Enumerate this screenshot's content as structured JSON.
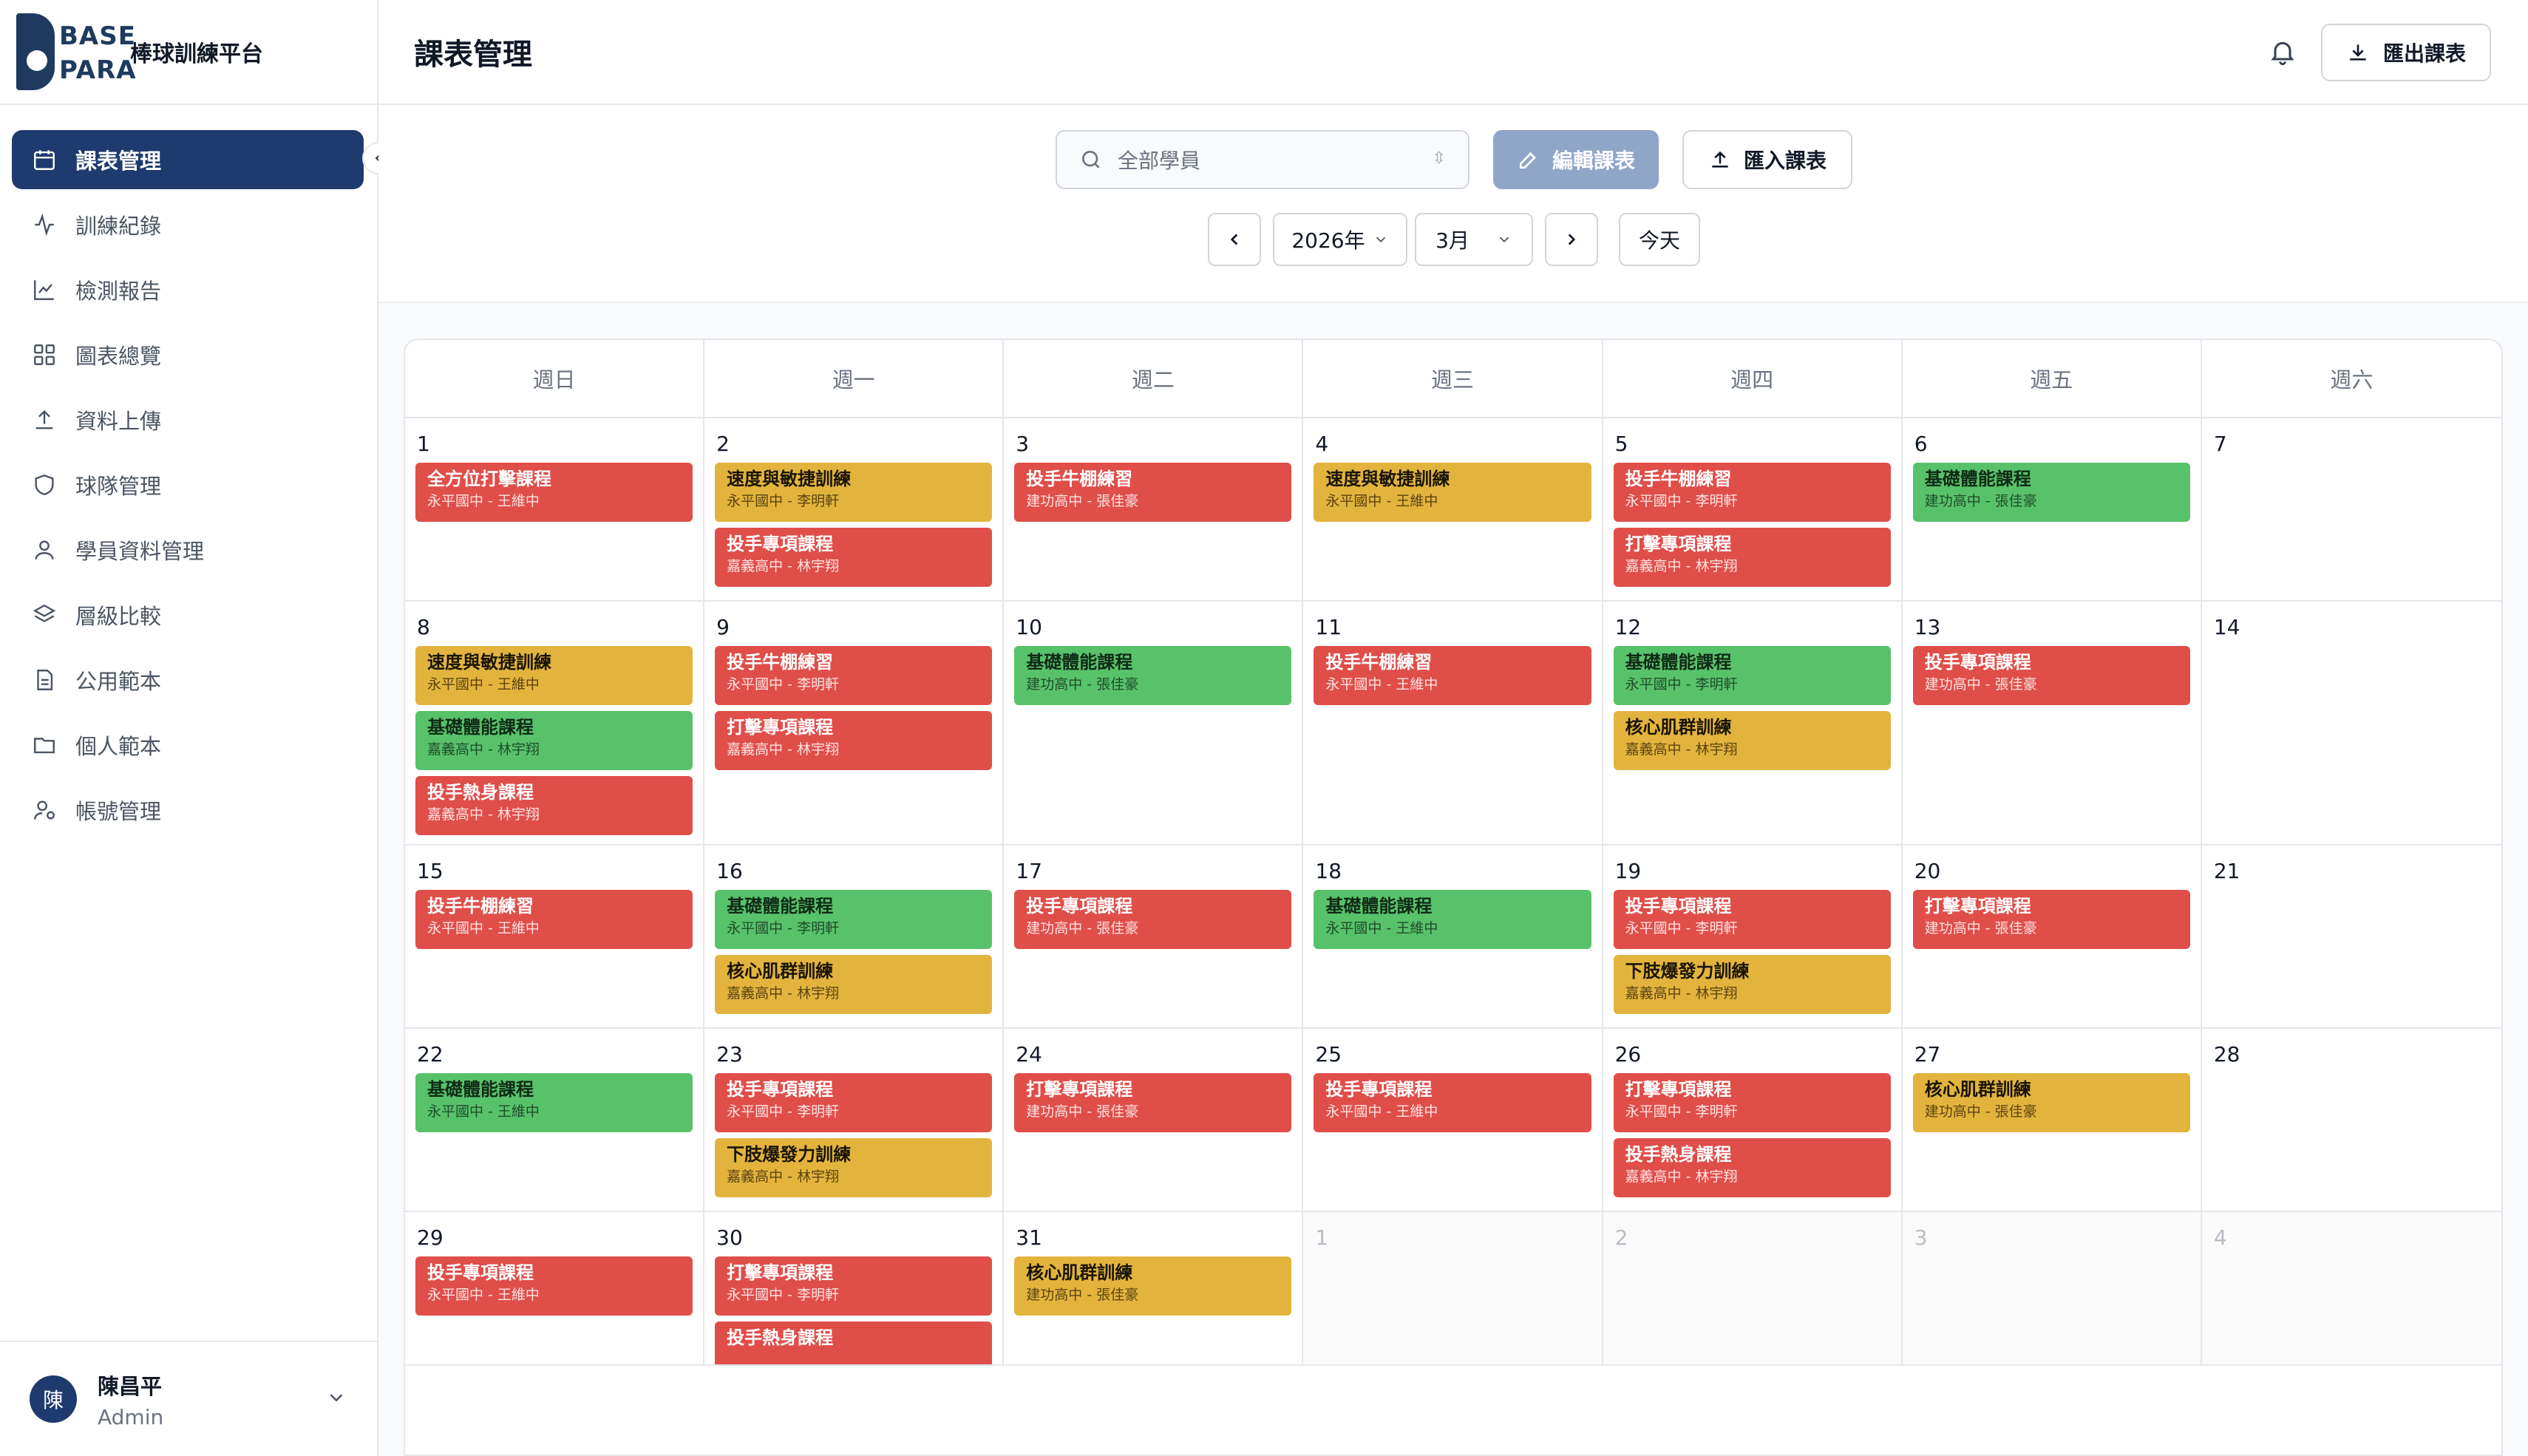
{
  "app": {
    "brand_line1": "BASE",
    "brand_line2": "PARA",
    "brand_name": "棒球訓練平台"
  },
  "sidebar": {
    "items": [
      {
        "label": "課表管理",
        "icon": "calendar-icon",
        "active": true
      },
      {
        "label": "訓練紀錄",
        "icon": "activity-icon"
      },
      {
        "label": "檢測報告",
        "icon": "line-chart-icon"
      },
      {
        "label": "圖表總覽",
        "icon": "grid-icon"
      },
      {
        "label": "資料上傳",
        "icon": "upload-icon"
      },
      {
        "label": "球隊管理",
        "icon": "shield-icon"
      },
      {
        "label": "學員資料管理",
        "icon": "user-icon"
      },
      {
        "label": "層級比較",
        "icon": "layers-icon"
      },
      {
        "label": "公用範本",
        "icon": "file-text-icon"
      },
      {
        "label": "個人範本",
        "icon": "folder-icon"
      },
      {
        "label": "帳號管理",
        "icon": "user-cog-icon"
      }
    ],
    "user": {
      "avatar": "陳",
      "name": "陳昌平",
      "role": "Admin"
    }
  },
  "header": {
    "title": "課表管理",
    "export_label": "匯出課表"
  },
  "toolbar": {
    "search_placeholder": "全部學員",
    "edit_label": "編輯課表",
    "import_label": "匯入課表",
    "year": "2026年",
    "month": "3月",
    "today_label": "今天"
  },
  "colors": {
    "primary": "#1e3a6e",
    "red": "#e04e4a",
    "green": "#58c26a",
    "yellow": "#e3b43d"
  },
  "calendar": {
    "weekdays": [
      "週日",
      "週一",
      "週二",
      "週三",
      "週四",
      "週五",
      "週六"
    ],
    "weeks": [
      [
        {
          "day": "1",
          "events": [
            {
              "title": "全方位打擊課程",
              "sub": "永平國中 - 王維中",
              "color": "red"
            }
          ]
        },
        {
          "day": "2",
          "events": [
            {
              "title": "速度與敏捷訓練",
              "sub": "永平國中 - 李明軒",
              "color": "yellow"
            },
            {
              "title": "投手專項課程",
              "sub": "嘉義高中 - 林宇翔",
              "color": "red"
            }
          ]
        },
        {
          "day": "3",
          "events": [
            {
              "title": "投手牛棚練習",
              "sub": "建功高中 - 張佳豪",
              "color": "red"
            }
          ]
        },
        {
          "day": "4",
          "events": [
            {
              "title": "速度與敏捷訓練",
              "sub": "永平國中 - 王維中",
              "color": "yellow"
            }
          ]
        },
        {
          "day": "5",
          "events": [
            {
              "title": "投手牛棚練習",
              "sub": "永平國中 - 李明軒",
              "color": "red"
            },
            {
              "title": "打擊專項課程",
              "sub": "嘉義高中 - 林宇翔",
              "color": "red"
            }
          ]
        },
        {
          "day": "6",
          "events": [
            {
              "title": "基礎體能課程",
              "sub": "建功高中 - 張佳豪",
              "color": "green"
            }
          ]
        },
        {
          "day": "7",
          "events": []
        }
      ],
      [
        {
          "day": "8",
          "events": [
            {
              "title": "速度與敏捷訓練",
              "sub": "永平國中 - 王維中",
              "color": "yellow"
            },
            {
              "title": "基礎體能課程",
              "sub": "嘉義高中 - 林宇翔",
              "color": "green"
            },
            {
              "title": "投手熱身課程",
              "sub": "嘉義高中 - 林宇翔",
              "color": "red"
            }
          ]
        },
        {
          "day": "9",
          "events": [
            {
              "title": "投手牛棚練習",
              "sub": "永平國中 - 李明軒",
              "color": "red"
            },
            {
              "title": "打擊專項課程",
              "sub": "嘉義高中 - 林宇翔",
              "color": "red"
            }
          ]
        },
        {
          "day": "10",
          "events": [
            {
              "title": "基礎體能課程",
              "sub": "建功高中 - 張佳豪",
              "color": "green"
            }
          ]
        },
        {
          "day": "11",
          "events": [
            {
              "title": "投手牛棚練習",
              "sub": "永平國中 - 王維中",
              "color": "red"
            }
          ]
        },
        {
          "day": "12",
          "events": [
            {
              "title": "基礎體能課程",
              "sub": "永平國中 - 李明軒",
              "color": "green"
            },
            {
              "title": "核心肌群訓練",
              "sub": "嘉義高中 - 林宇翔",
              "color": "yellow"
            }
          ]
        },
        {
          "day": "13",
          "events": [
            {
              "title": "投手專項課程",
              "sub": "建功高中 - 張佳豪",
              "color": "red"
            }
          ]
        },
        {
          "day": "14",
          "events": []
        }
      ],
      [
        {
          "day": "15",
          "events": [
            {
              "title": "投手牛棚練習",
              "sub": "永平國中 - 王維中",
              "color": "red"
            }
          ]
        },
        {
          "day": "16",
          "events": [
            {
              "title": "基礎體能課程",
              "sub": "永平國中 - 李明軒",
              "color": "green"
            },
            {
              "title": "核心肌群訓練",
              "sub": "嘉義高中 - 林宇翔",
              "color": "yellow"
            }
          ]
        },
        {
          "day": "17",
          "events": [
            {
              "title": "投手專項課程",
              "sub": "建功高中 - 張佳豪",
              "color": "red"
            }
          ]
        },
        {
          "day": "18",
          "events": [
            {
              "title": "基礎體能課程",
              "sub": "永平國中 - 王維中",
              "color": "green"
            }
          ]
        },
        {
          "day": "19",
          "events": [
            {
              "title": "投手專項課程",
              "sub": "永平國中 - 李明軒",
              "color": "red"
            },
            {
              "title": "下肢爆發力訓練",
              "sub": "嘉義高中 - 林宇翔",
              "color": "yellow"
            }
          ]
        },
        {
          "day": "20",
          "events": [
            {
              "title": "打擊專項課程",
              "sub": "建功高中 - 張佳豪",
              "color": "red"
            }
          ]
        },
        {
          "day": "21",
          "events": []
        }
      ],
      [
        {
          "day": "22",
          "events": [
            {
              "title": "基礎體能課程",
              "sub": "永平國中 - 王維中",
              "color": "green"
            }
          ]
        },
        {
          "day": "23",
          "events": [
            {
              "title": "投手專項課程",
              "sub": "永平國中 - 李明軒",
              "color": "red"
            },
            {
              "title": "下肢爆發力訓練",
              "sub": "嘉義高中 - 林宇翔",
              "color": "yellow"
            }
          ]
        },
        {
          "day": "24",
          "events": [
            {
              "title": "打擊專項課程",
              "sub": "建功高中 - 張佳豪",
              "color": "red"
            }
          ]
        },
        {
          "day": "25",
          "events": [
            {
              "title": "投手專項課程",
              "sub": "永平國中 - 王維中",
              "color": "red"
            }
          ]
        },
        {
          "day": "26",
          "events": [
            {
              "title": "打擊專項課程",
              "sub": "永平國中 - 李明軒",
              "color": "red"
            },
            {
              "title": "投手熱身課程",
              "sub": "嘉義高中 - 林宇翔",
              "color": "red"
            }
          ]
        },
        {
          "day": "27",
          "events": [
            {
              "title": "核心肌群訓練",
              "sub": "建功高中 - 張佳豪",
              "color": "yellow"
            }
          ]
        },
        {
          "day": "28",
          "events": []
        }
      ],
      [
        {
          "day": "29",
          "events": [
            {
              "title": "投手專項課程",
              "sub": "永平國中 - 王維中",
              "color": "red"
            }
          ]
        },
        {
          "day": "30",
          "events": [
            {
              "title": "打擊專項課程",
              "sub": "永平國中 - 李明軒",
              "color": "red"
            },
            {
              "title": "投手熱身課程",
              "sub": "",
              "color": "red"
            }
          ]
        },
        {
          "day": "31",
          "events": [
            {
              "title": "核心肌群訓練",
              "sub": "建功高中 - 張佳豪",
              "color": "yellow"
            }
          ]
        },
        {
          "day": "1",
          "other": true,
          "events": []
        },
        {
          "day": "2",
          "other": true,
          "events": []
        },
        {
          "day": "3",
          "other": true,
          "events": []
        },
        {
          "day": "4",
          "other": true,
          "events": []
        }
      ]
    ]
  }
}
